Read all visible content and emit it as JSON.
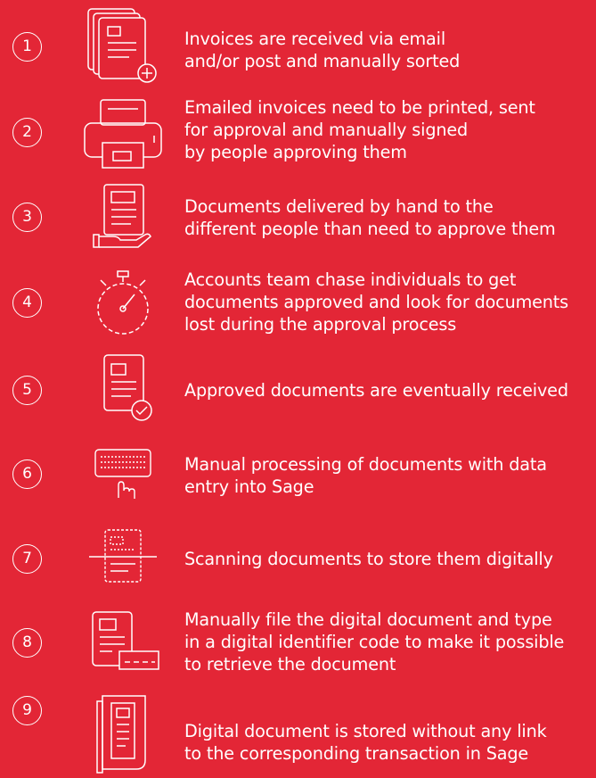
{
  "steps": [
    {
      "number": "1",
      "icon": "documents-add-icon",
      "lines": [
        "Invoices are received via email",
        "and/or post and manually sorted"
      ]
    },
    {
      "number": "2",
      "icon": "printer-icon",
      "lines": [
        "Emailed invoices need to be printed, sent",
        "for approval and manually signed",
        "by people approving them"
      ]
    },
    {
      "number": "3",
      "icon": "hand-document-icon",
      "lines": [
        "Documents delivered by hand to the",
        "different people than need to approve them"
      ]
    },
    {
      "number": "4",
      "icon": "stopwatch-icon",
      "lines": [
        "Accounts team chase individuals to get",
        "documents approved and look for documents",
        "lost during the approval process"
      ]
    },
    {
      "number": "5",
      "icon": "document-check-icon",
      "lines": [
        "Approved documents are eventually received"
      ]
    },
    {
      "number": "6",
      "icon": "keyboard-typing-icon",
      "lines": [
        "Manual processing of documents with data",
        "entry into Sage"
      ]
    },
    {
      "number": "7",
      "icon": "scanner-icon",
      "lines": [
        "Scanning documents to store them digitally"
      ]
    },
    {
      "number": "8",
      "icon": "document-code-icon",
      "lines": [
        "Manually file the digital document and type",
        "in a digital identifier code to make it possible",
        "to retrieve the document"
      ]
    },
    {
      "number": "9",
      "icon": "document-storage-icon",
      "lines": [
        "Digital document is stored without any link",
        "to the corresponding transaction in Sage"
      ]
    }
  ]
}
